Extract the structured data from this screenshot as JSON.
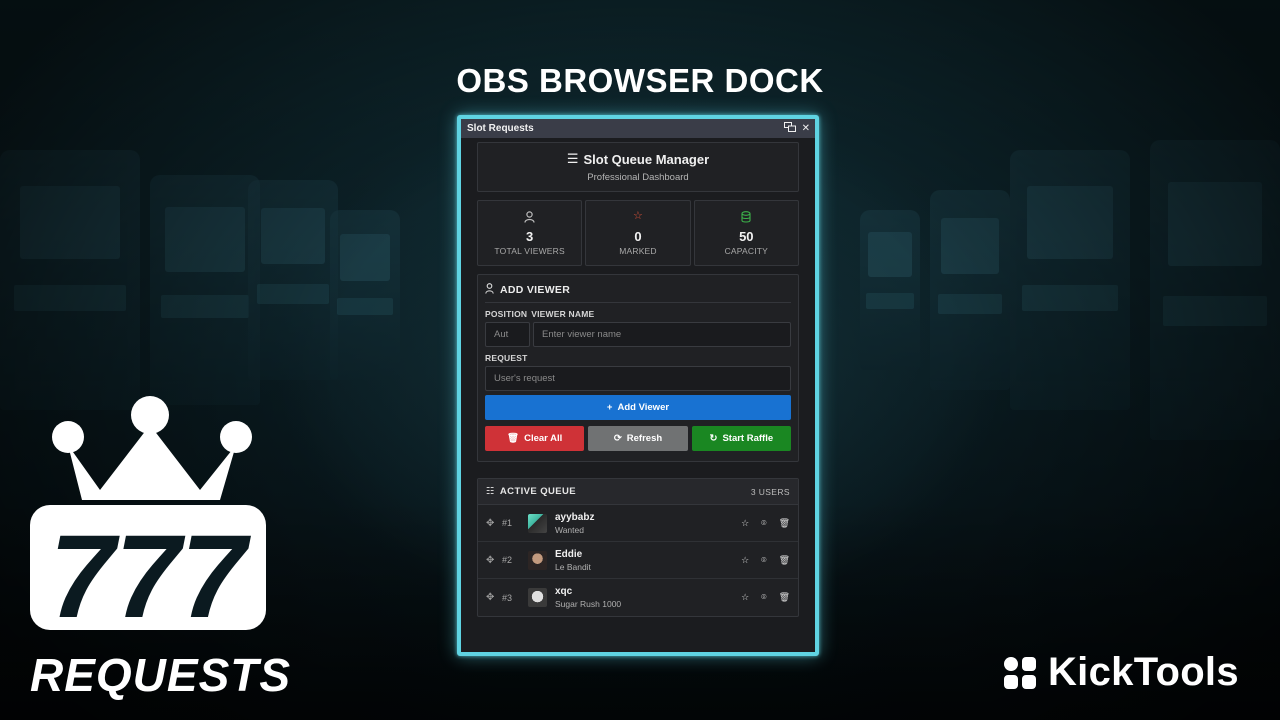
{
  "headline": "OBS BROWSER DOCK",
  "logo": {
    "number": "777",
    "text": "REQUESTS"
  },
  "brand": {
    "name": "KickTools"
  },
  "dock": {
    "window_title": "Slot Requests",
    "header": {
      "title": "Slot Queue Manager",
      "subtitle": "Professional Dashboard"
    },
    "stats": [
      {
        "value": "3",
        "label": "TOTAL VIEWERS",
        "icon": "user-icon",
        "color": "#bdbdbd"
      },
      {
        "value": "0",
        "label": "MARKED",
        "icon": "star-icon",
        "color": "#e6553a"
      },
      {
        "value": "50",
        "label": "CAPACITY",
        "icon": "database-icon",
        "color": "#3cb24a"
      }
    ],
    "add_viewer": {
      "title": "ADD VIEWER",
      "position_label": "POSITION",
      "name_label": "VIEWER NAME",
      "position_placeholder": "Aut",
      "name_placeholder": "Enter viewer name",
      "request_label": "REQUEST",
      "request_placeholder": "User's request",
      "add_button": "Add Viewer",
      "clear_button": "Clear All",
      "refresh_button": "Refresh",
      "raffle_button": "Start Raffle"
    },
    "queue": {
      "title": "ACTIVE QUEUE",
      "count": "3 USERS",
      "items": [
        {
          "pos": "#1",
          "name": "ayybabz",
          "request": "Wanted"
        },
        {
          "pos": "#2",
          "name": "Eddie",
          "request": "Le Bandit"
        },
        {
          "pos": "#3",
          "name": "xqc",
          "request": "Sugar Rush 1000"
        }
      ]
    }
  },
  "colors": {
    "accent_border": "#5fd3e2",
    "add_button": "#1872d2",
    "clear_button": "#cf3237",
    "refresh_button": "#707273",
    "raffle_button": "#1a8722"
  }
}
